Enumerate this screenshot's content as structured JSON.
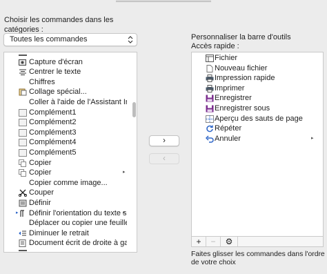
{
  "left": {
    "label": "Choisir les commandes dans les catégories :",
    "category_select": "Toutes les commandes",
    "items": [
      {
        "label": "",
        "icon": "partial-icon"
      },
      {
        "label": "Capture d'écran",
        "icon": "screenshot-icon"
      },
      {
        "label": "Centrer le texte",
        "icon": "align-center-icon"
      },
      {
        "label": "Chiffres",
        "icon": ""
      },
      {
        "label": "Collage spécial...",
        "icon": "paste-special-icon"
      },
      {
        "label": "Coller à l'aide de l'Assistant Imp...",
        "icon": ""
      },
      {
        "label": "Complément1",
        "icon": "addin-icon"
      },
      {
        "label": "Complément2",
        "icon": "addin-icon"
      },
      {
        "label": "Complément3",
        "icon": "addin-icon"
      },
      {
        "label": "Complément4",
        "icon": "addin-icon"
      },
      {
        "label": "Complément5",
        "icon": "addin-icon"
      },
      {
        "label": "Copier",
        "icon": "copy-icon"
      },
      {
        "label": "Copier",
        "icon": "copy-icon",
        "submenu": "▸"
      },
      {
        "label": "Copier comme image...",
        "icon": ""
      },
      {
        "label": "Couper",
        "icon": "scissors-icon"
      },
      {
        "label": "Définir",
        "icon": "define-icon"
      },
      {
        "label": "Définir l'orientation du texte sel...",
        "icon": "text-direction-icon",
        "submenu": "▸"
      },
      {
        "label": "Déplacer ou copier une feuille...",
        "icon": ""
      },
      {
        "label": "Diminuer le retrait",
        "icon": "decrease-indent-icon"
      },
      {
        "label": "Document écrit de droite à gau...",
        "icon": "rtl-doc-icon"
      },
      {
        "label": "",
        "icon": "partial-icon"
      }
    ]
  },
  "buttons": {
    "add": "›",
    "remove": "‹"
  },
  "right": {
    "label_line1": "Personnaliser la barre d'outils",
    "label_line2": "Accès rapide :",
    "items": [
      {
        "label": "Fichier",
        "icon": "file-icon"
      },
      {
        "label": "Nouveau fichier",
        "icon": "new-file-icon"
      },
      {
        "label": "Impression rapide",
        "icon": "quick-print-icon"
      },
      {
        "label": "Imprimer",
        "icon": "print-icon"
      },
      {
        "label": "Enregistrer",
        "icon": "save-icon"
      },
      {
        "label": "Enregistrer sous",
        "icon": "save-as-icon"
      },
      {
        "label": "Aperçu des sauts de page",
        "icon": "page-break-preview-icon"
      },
      {
        "label": "Répéter",
        "icon": "repeat-icon"
      },
      {
        "label": "Annuler",
        "icon": "undo-icon",
        "submenu": "▸"
      }
    ],
    "toolbar": {
      "plus": "+",
      "minus": "−",
      "gear": "⚙"
    }
  },
  "hint": "Faites glisser les commandes dans l'ordre de votre choix",
  "colors": {
    "accent": "#2a63c7",
    "save": "#7b2d8e",
    "print": "#4a5a6a"
  }
}
